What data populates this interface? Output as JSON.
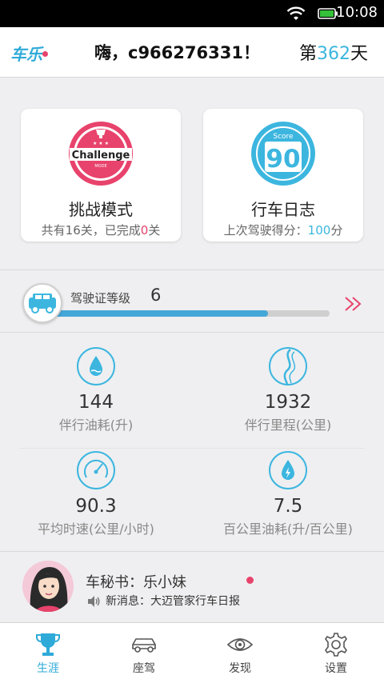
{
  "status_bar": {
    "time": "10:08"
  },
  "header": {
    "logo": "车乐",
    "greeting": "嗨，c966276331！",
    "day_prefix": "第",
    "day_count": "362",
    "day_suffix": "天"
  },
  "cards": {
    "challenge": {
      "badge_text": "Challenge",
      "badge_sub": "MODE",
      "title": "挑战模式",
      "sub_prefix": "共有16关，已完成",
      "sub_value": "0",
      "sub_suffix": "关"
    },
    "log": {
      "badge_top": "Score",
      "badge_value": "90",
      "title": "行车日志",
      "sub_prefix": "上次驾驶得分：",
      "sub_value": "100",
      "sub_suffix": "分"
    }
  },
  "license": {
    "label": "驾驶证等级",
    "level": "6",
    "progress": 0.78
  },
  "stats": [
    {
      "icon": "water-drop-icon",
      "value": "144",
      "label": "伴行油耗(升)"
    },
    {
      "icon": "road-icon",
      "value": "1932",
      "label": "伴行里程(公里)"
    },
    {
      "icon": "speedometer-icon",
      "value": "90.3",
      "label": "平均时速(公里/小时)"
    },
    {
      "icon": "fuel-drop-icon",
      "value": "7.5",
      "label": "百公里油耗(升/百公里)"
    }
  ],
  "secretary": {
    "name": "车秘书：乐小妹",
    "message": "新消息：大迈管家行车日报"
  },
  "tabs": [
    {
      "label": "生涯",
      "icon": "trophy-icon",
      "active": true
    },
    {
      "label": "座驾",
      "icon": "car-icon",
      "active": false
    },
    {
      "label": "发现",
      "icon": "eye-icon",
      "active": false
    },
    {
      "label": "设置",
      "icon": "gear-icon",
      "active": false
    }
  ],
  "colors": {
    "accent": "#3cb6df",
    "pink": "#e8436c"
  }
}
